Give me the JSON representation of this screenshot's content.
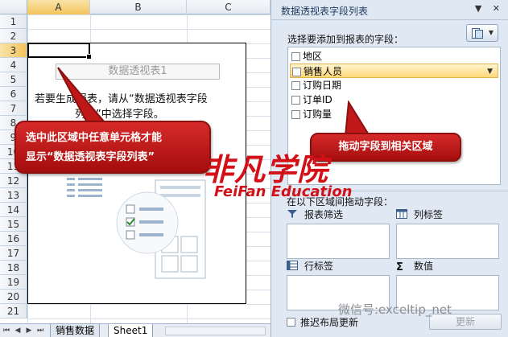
{
  "sheet": {
    "columns": [
      "A",
      "B",
      "C"
    ],
    "active_column": "A",
    "rows": [
      "1",
      "2",
      "3",
      "4",
      "5",
      "6",
      "7",
      "8",
      "9",
      "10",
      "11",
      "12",
      "13",
      "14",
      "15",
      "16",
      "17",
      "18",
      "19",
      "20",
      "21"
    ],
    "active_row": "3",
    "tabs": [
      "销售数据",
      "Sheet1"
    ],
    "active_tab": "Sheet1"
  },
  "pivot": {
    "title": "数据透视表1",
    "help_line1": "若要生成报表，请从“数据透视表字段",
    "help_line2": "列表”中选择字段。"
  },
  "callouts": {
    "left_line1": "选中此区域中任意单元格才能",
    "left_line2": "显示“数据透视表字段列表”",
    "right": "拖动字段到相关区域"
  },
  "pane": {
    "title": "数据透视表字段列表",
    "choose_label": "选择要添加到报表的字段：",
    "fields": [
      {
        "label": "地区",
        "highlighted": false
      },
      {
        "label": "销售人员",
        "highlighted": true
      },
      {
        "label": "订购日期",
        "highlighted": false
      },
      {
        "label": "订单ID",
        "highlighted": false
      },
      {
        "label": "订购量",
        "highlighted": false
      }
    ],
    "drag_label": "在以下区域间拖动字段：",
    "areas": {
      "filter": "报表筛选",
      "columns": "列标签",
      "rows": "行标签",
      "values": "数值"
    },
    "defer_label": "推迟布局更新",
    "update_label": "更新"
  },
  "watermark": {
    "logo": "非凡学院",
    "sub": "FeiFan Education",
    "wechat": "微信号:exceltip_net"
  },
  "colors": {
    "callout": "#c01818",
    "pane_bg": "#dfe8f3",
    "brand": "#d31018"
  }
}
